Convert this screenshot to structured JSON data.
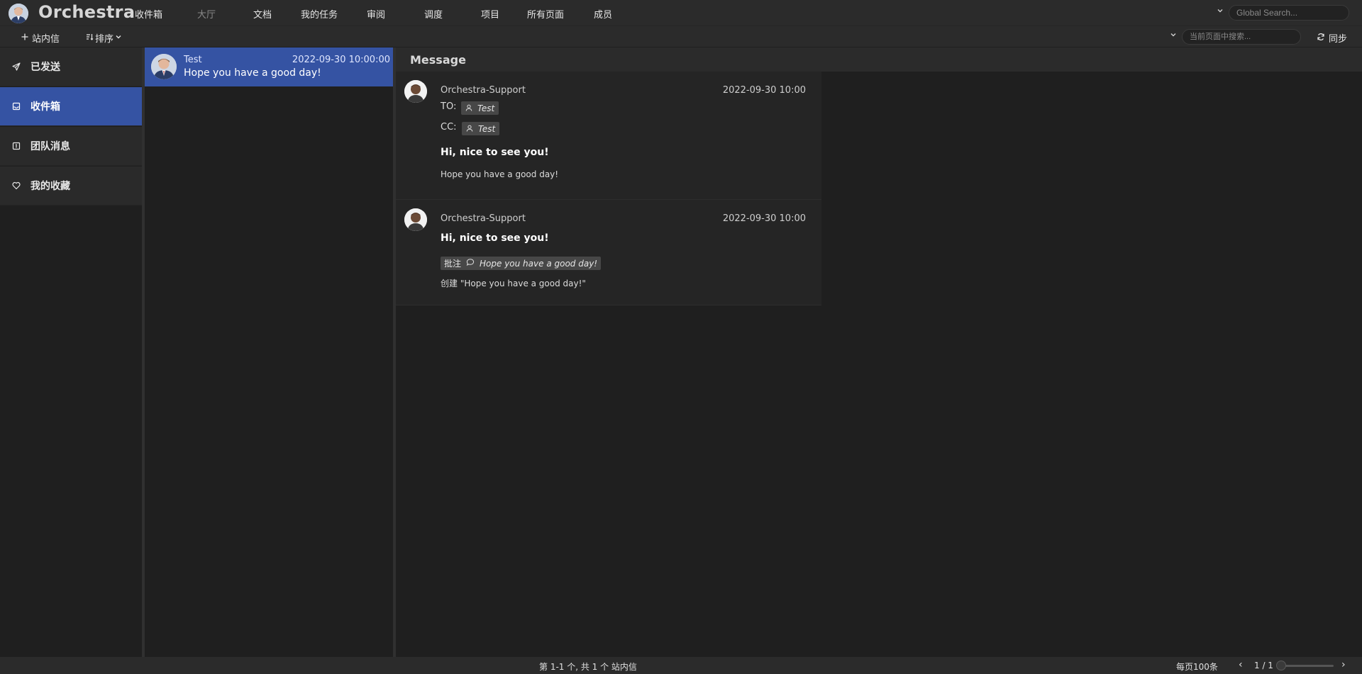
{
  "app": {
    "title": "Orchestra"
  },
  "nav": {
    "items": [
      "收件箱",
      "大厅",
      "文档",
      "我的任务",
      "审阅",
      "调度",
      "项目",
      "所有页面",
      "成员"
    ]
  },
  "search": {
    "global_placeholder": "Global Search...",
    "page_placeholder": "当前页面中搜索..."
  },
  "toolbar": {
    "new_label": "站内信",
    "sort_label": "排序",
    "sync_label": "同步"
  },
  "sidebar": {
    "items": [
      {
        "label": "已发送",
        "icon": "send-icon"
      },
      {
        "label": "收件箱",
        "icon": "inbox-icon",
        "active": true
      },
      {
        "label": "团队消息",
        "icon": "team-message-icon"
      },
      {
        "label": "我的收藏",
        "icon": "heart-icon"
      }
    ]
  },
  "list": {
    "items": [
      {
        "sender": "Test",
        "time": "2022-09-30 10:00:00",
        "subject": "Hope you have a good day!"
      }
    ]
  },
  "detail": {
    "title": "Message",
    "entries": [
      {
        "from": "Orchestra-Support",
        "time": "2022-09-30 10:00",
        "to_label": "TO:",
        "to": "Test",
        "cc_label": "CC:",
        "cc": "Test",
        "headline": "Hi, nice to see you!",
        "body": "Hope you have a good day!"
      },
      {
        "from": "Orchestra-Support",
        "time": "2022-09-30 10:00",
        "headline": "Hi, nice to see you!",
        "note_label": "批注",
        "note_text": "Hope you have a good day!",
        "body": "创建 \"Hope you have a good day!\""
      }
    ]
  },
  "footer": {
    "count": "第 1-1 个, 共 1 个 站内信",
    "per_page": "每页100条",
    "page": "1 / 1",
    "prev": "‹",
    "next": "›"
  },
  "colors": {
    "accent": "#3553a3",
    "topbar": "#2b2b2b",
    "background": "#1f1f1f"
  }
}
